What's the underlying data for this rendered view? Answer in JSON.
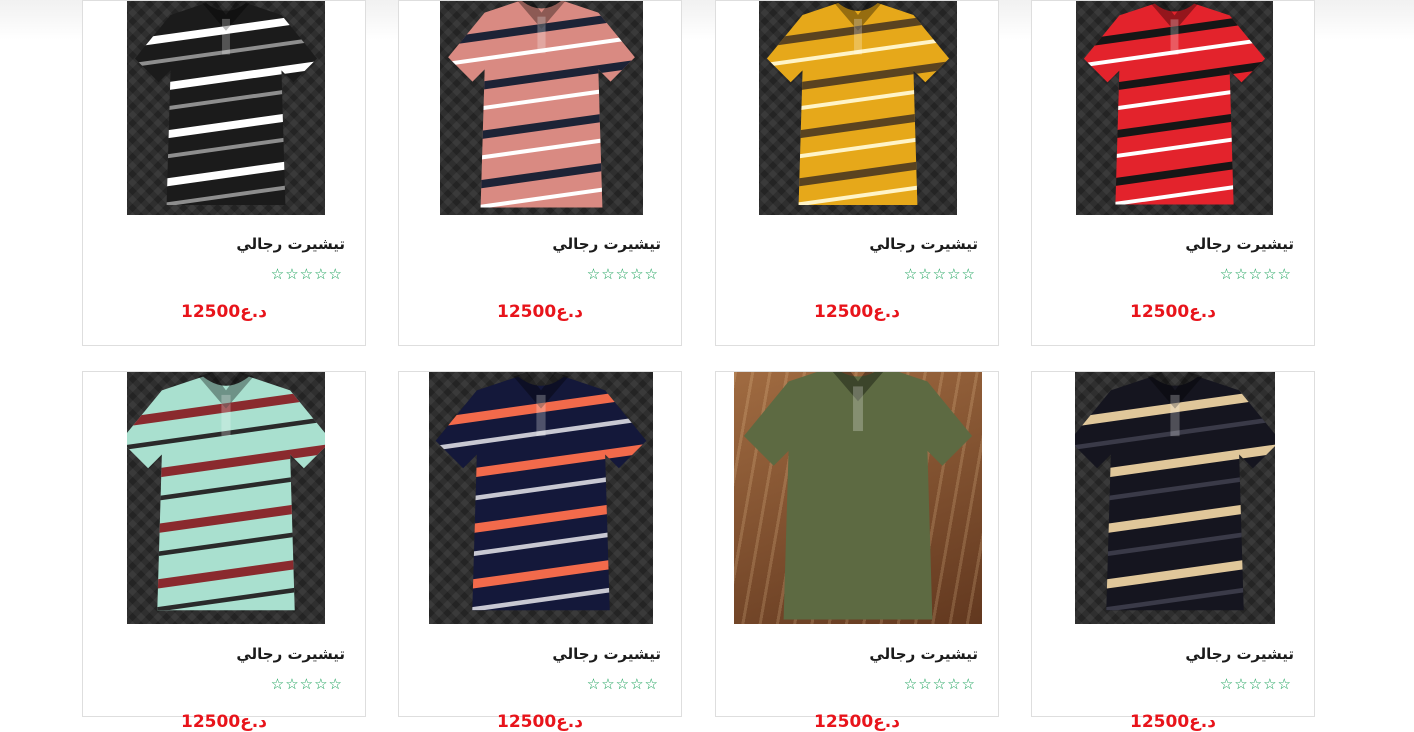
{
  "products": [
    {
      "title": "تيشيرت رجالي",
      "price": "د.ع12500",
      "rating": "☆☆☆☆☆",
      "shirt_color": "#1b1b1b",
      "stripe_colors": [
        "#ffffff",
        "#8e8e8e"
      ],
      "photo": "black-white-striped-polo"
    },
    {
      "title": "تيشيرت رجالي",
      "price": "د.ع12500",
      "rating": "☆☆☆☆☆",
      "shirt_color": "#d98a82",
      "stripe_colors": [
        "#1d2336",
        "#ffffff"
      ],
      "photo": "pink-striped-polo"
    },
    {
      "title": "تيشيرت رجالي",
      "price": "د.ع12500",
      "rating": "☆☆☆☆☆",
      "shirt_color": "#e6a81a",
      "stripe_colors": [
        "#5a4320",
        "#fff4c8"
      ],
      "photo": "mustard-striped-polo"
    },
    {
      "title": "تيشيرت رجالي",
      "price": "د.ع12500",
      "rating": "☆☆☆☆☆",
      "shirt_color": "#e3232c",
      "stripe_colors": [
        "#161616",
        "#ffffff"
      ],
      "photo": "red-striped-polo"
    },
    {
      "title": "تيشيرت رجالي",
      "price": "د.ع12500",
      "rating": "☆☆☆☆☆",
      "shirt_color": "#a9e0cf",
      "stripe_colors": [
        "#8a2a2e",
        "#2a2a2a"
      ],
      "photo": "mint-striped-polo"
    },
    {
      "title": "تيشيرت رجالي",
      "price": "د.ع12500",
      "rating": "☆☆☆☆☆",
      "shirt_color": "#14183a",
      "stripe_colors": [
        "#f26a4b",
        "#c8c8d2"
      ],
      "photo": "navy-striped-polo"
    },
    {
      "title": "تيشيرت رجالي",
      "price": "د.ع12500",
      "rating": "☆☆☆☆☆",
      "shirt_color": "#5d6a42",
      "stripe_colors": [],
      "photo": "olive-polo-on-wood"
    },
    {
      "title": "تيشيرت رجالي",
      "price": "د.ع12500",
      "rating": "☆☆☆☆☆",
      "shirt_color": "#15151f",
      "stripe_colors": [
        "#e0c79a",
        "#3a3a48"
      ],
      "photo": "black-check-polo"
    }
  ]
}
